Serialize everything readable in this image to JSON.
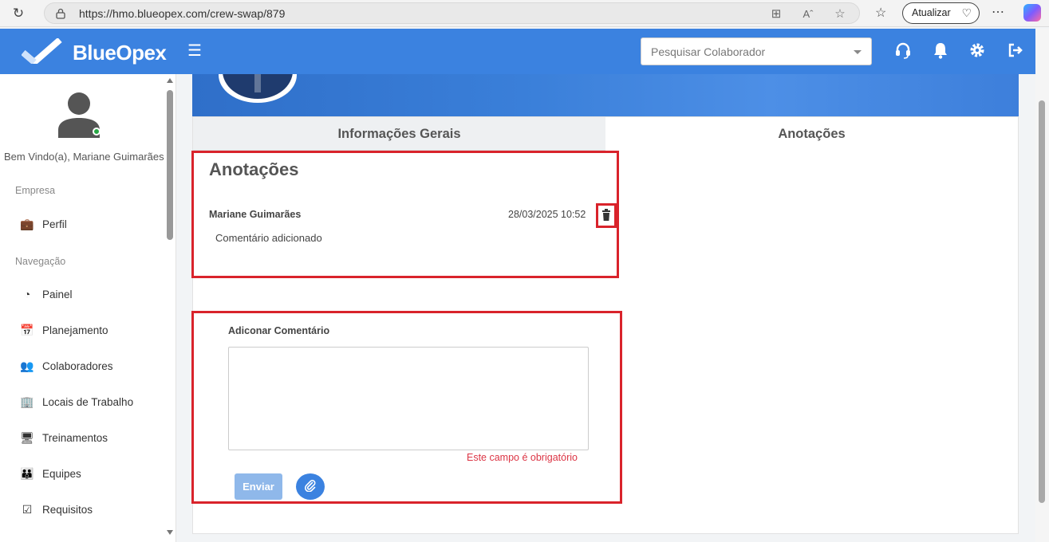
{
  "browser": {
    "url": "https://hmo.blueopex.com/crew-swap/879",
    "update_label": "Atualizar"
  },
  "header": {
    "logo_text": "BlueOpex",
    "search_placeholder": "Pesquisar Colaborador",
    "icons": [
      "headset-icon",
      "bell-icon",
      "gear-icon",
      "logout-icon"
    ]
  },
  "sidebar": {
    "welcome": "Bem Vindo(a), Mariane Guimarães",
    "section_company": "Empresa",
    "section_nav": "Navegação",
    "items": [
      {
        "label": "Perfil",
        "icon": "briefcase-icon"
      },
      {
        "label": "Painel",
        "icon": "dashboard-icon"
      },
      {
        "label": "Planejamento",
        "icon": "calendar-icon"
      },
      {
        "label": "Colaboradores",
        "icon": "users-icon"
      },
      {
        "label": "Locais de Trabalho",
        "icon": "building-icon"
      },
      {
        "label": "Treinamentos",
        "icon": "devices-icon"
      },
      {
        "label": "Equipes",
        "icon": "team-icon"
      },
      {
        "label": "Requisitos",
        "icon": "checkbox-icon"
      }
    ]
  },
  "tabs": {
    "info": "Informações Gerais",
    "notes": "Anotações"
  },
  "notes": {
    "title": "Anotações",
    "entries": [
      {
        "author": "Mariane Guimarães",
        "date": "28/03/2025 10:52",
        "text": "Comentário adicionado"
      }
    ]
  },
  "form": {
    "label": "Adiconar Comentário",
    "value": "",
    "error": "Este campo é obrigatório",
    "send_label": "Enviar"
  },
  "colors": {
    "primary": "#3b82e0",
    "highlight": "#d9232b",
    "error": "#dc3545"
  }
}
